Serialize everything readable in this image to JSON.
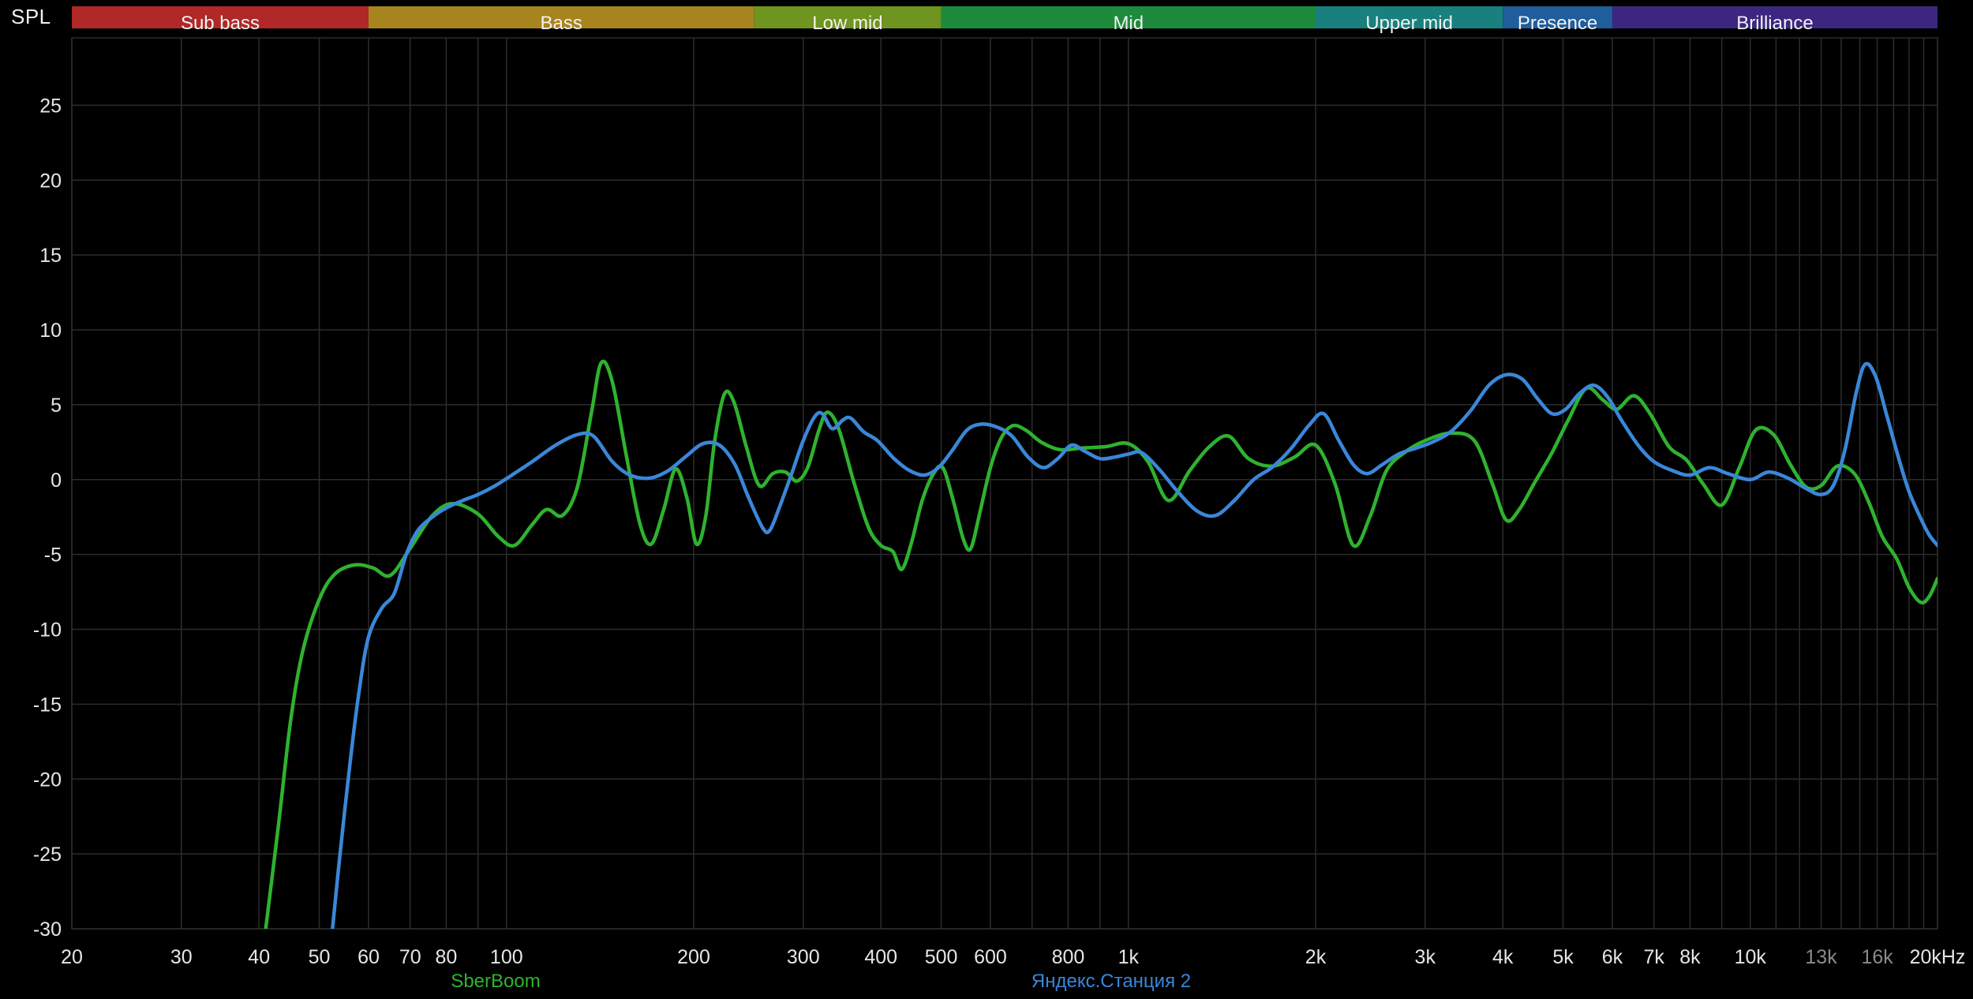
{
  "colors": {
    "background": "#000000",
    "grid": "#2c2c2c",
    "tick": "#e6e6e6",
    "tick_dim": "#8a8a8a",
    "band_text": "#f2f2f2"
  },
  "chart_data": {
    "type": "line",
    "title": "",
    "ylabel": "SPL",
    "xscale": "log",
    "xlim": [
      20,
      20000
    ],
    "ylim": [
      -30,
      29.5
    ],
    "grid": true,
    "legend_position": "bottom",
    "y_tick_values": [
      25,
      20,
      15,
      10,
      5,
      0,
      -5,
      -10,
      -15,
      -20,
      -25,
      -30
    ],
    "y_tick_labels": [
      "25",
      "20",
      "15",
      "10",
      "5",
      "0",
      "-5",
      "-10",
      "-15",
      "-20",
      "-25",
      "-30"
    ],
    "x_ticks": [
      {
        "f": 20,
        "label": "20",
        "dim": false
      },
      {
        "f": 30,
        "label": "30",
        "dim": false
      },
      {
        "f": 40,
        "label": "40",
        "dim": false
      },
      {
        "f": 50,
        "label": "50",
        "dim": false
      },
      {
        "f": 60,
        "label": "60",
        "dim": false
      },
      {
        "f": 70,
        "label": "70",
        "dim": false
      },
      {
        "f": 80,
        "label": "80",
        "dim": false
      },
      {
        "f": 100,
        "label": "100",
        "dim": false
      },
      {
        "f": 200,
        "label": "200",
        "dim": false
      },
      {
        "f": 300,
        "label": "300",
        "dim": false
      },
      {
        "f": 400,
        "label": "400",
        "dim": false
      },
      {
        "f": 500,
        "label": "500",
        "dim": false
      },
      {
        "f": 600,
        "label": "600",
        "dim": false
      },
      {
        "f": 800,
        "label": "800",
        "dim": false
      },
      {
        "f": 1000,
        "label": "1k",
        "dim": false
      },
      {
        "f": 2000,
        "label": "2k",
        "dim": false
      },
      {
        "f": 3000,
        "label": "3k",
        "dim": false
      },
      {
        "f": 4000,
        "label": "4k",
        "dim": false
      },
      {
        "f": 5000,
        "label": "5k",
        "dim": false
      },
      {
        "f": 6000,
        "label": "6k",
        "dim": false
      },
      {
        "f": 7000,
        "label": "7k",
        "dim": false
      },
      {
        "f": 8000,
        "label": "8k",
        "dim": false
      },
      {
        "f": 10000,
        "label": "10k",
        "dim": false
      },
      {
        "f": 13000,
        "label": "13k",
        "dim": true
      },
      {
        "f": 16000,
        "label": "16k",
        "dim": true
      },
      {
        "f": 20000,
        "label": "20kHz",
        "dim": false
      }
    ],
    "bands": [
      {
        "label": "Sub bass",
        "color": "#b02828",
        "f_start": 20,
        "f_end": 60
      },
      {
        "label": "Bass",
        "color": "#a8841f",
        "f_start": 60,
        "f_end": 250
      },
      {
        "label": "Low mid",
        "color": "#6f941f",
        "f_start": 250,
        "f_end": 500
      },
      {
        "label": "Mid",
        "color": "#1e8a3c",
        "f_start": 500,
        "f_end": 2000
      },
      {
        "label": "Upper mid",
        "color": "#19807d",
        "f_start": 2000,
        "f_end": 4000
      },
      {
        "label": "Presence",
        "color": "#1f5d9c",
        "f_start": 4000,
        "f_end": 6000
      },
      {
        "label": "Brilliance",
        "color": "#3c2680",
        "f_start": 6000,
        "f_end": 20000
      }
    ],
    "series": [
      {
        "name": "SberBoom",
        "color": "#2fb22f",
        "points": [
          [
            41,
            -30
          ],
          [
            43,
            -23
          ],
          [
            45,
            -16
          ],
          [
            47,
            -11.5
          ],
          [
            50,
            -8
          ],
          [
            53,
            -6.3
          ],
          [
            57,
            -5.7
          ],
          [
            61,
            -5.9
          ],
          [
            65,
            -6.4
          ],
          [
            70,
            -4.6
          ],
          [
            76,
            -2.4
          ],
          [
            82,
            -1.6
          ],
          [
            90,
            -2.3
          ],
          [
            97,
            -3.8
          ],
          [
            103,
            -4.4
          ],
          [
            110,
            -3.0
          ],
          [
            116,
            -2.0
          ],
          [
            123,
            -2.4
          ],
          [
            130,
            -0.5
          ],
          [
            137,
            4.5
          ],
          [
            142,
            7.8
          ],
          [
            148,
            6.5
          ],
          [
            156,
            1.5
          ],
          [
            164,
            -3.0
          ],
          [
            171,
            -4.3
          ],
          [
            179,
            -2.0
          ],
          [
            187,
            0.7
          ],
          [
            195,
            -1.2
          ],
          [
            202,
            -4.3
          ],
          [
            209,
            -2.5
          ],
          [
            216,
            2.5
          ],
          [
            224,
            5.7
          ],
          [
            232,
            5.2
          ],
          [
            243,
            2.2
          ],
          [
            255,
            -0.4
          ],
          [
            268,
            0.4
          ],
          [
            281,
            0.5
          ],
          [
            293,
            -0.1
          ],
          [
            305,
            0.8
          ],
          [
            318,
            3.3
          ],
          [
            328,
            4.5
          ],
          [
            342,
            3.4
          ],
          [
            362,
            -0.2
          ],
          [
            382,
            -3.2
          ],
          [
            400,
            -4.4
          ],
          [
            418,
            -4.8
          ],
          [
            432,
            -6.0
          ],
          [
            448,
            -4.2
          ],
          [
            466,
            -1.4
          ],
          [
            486,
            0.4
          ],
          [
            503,
            0.8
          ],
          [
            522,
            -1.3
          ],
          [
            543,
            -4.0
          ],
          [
            558,
            -4.6
          ],
          [
            577,
            -2.2
          ],
          [
            600,
            0.8
          ],
          [
            625,
            2.8
          ],
          [
            652,
            3.6
          ],
          [
            684,
            3.3
          ],
          [
            724,
            2.5
          ],
          [
            776,
            2.0
          ],
          [
            840,
            2.1
          ],
          [
            920,
            2.2
          ],
          [
            1000,
            2.4
          ],
          [
            1075,
            1.2
          ],
          [
            1160,
            -1.4
          ],
          [
            1255,
            0.6
          ],
          [
            1350,
            2.2
          ],
          [
            1450,
            2.9
          ],
          [
            1560,
            1.4
          ],
          [
            1700,
            0.9
          ],
          [
            1850,
            1.5
          ],
          [
            2000,
            2.3
          ],
          [
            2150,
            -0.3
          ],
          [
            2300,
            -4.4
          ],
          [
            2450,
            -2.4
          ],
          [
            2600,
            0.6
          ],
          [
            2800,
            1.9
          ],
          [
            3000,
            2.6
          ],
          [
            3300,
            3.1
          ],
          [
            3600,
            2.6
          ],
          [
            3850,
            -0.3
          ],
          [
            4050,
            -2.7
          ],
          [
            4250,
            -2.0
          ],
          [
            4500,
            -0.2
          ],
          [
            4800,
            1.8
          ],
          [
            5100,
            4.0
          ],
          [
            5450,
            6.1
          ],
          [
            5800,
            5.3
          ],
          [
            6100,
            4.7
          ],
          [
            6500,
            5.6
          ],
          [
            6900,
            4.4
          ],
          [
            7400,
            2.2
          ],
          [
            7900,
            1.3
          ],
          [
            8400,
            -0.3
          ],
          [
            9000,
            -1.7
          ],
          [
            9600,
            0.8
          ],
          [
            10200,
            3.3
          ],
          [
            10900,
            3.0
          ],
          [
            11600,
            1.0
          ],
          [
            12300,
            -0.5
          ],
          [
            13000,
            -0.4
          ],
          [
            13800,
            0.9
          ],
          [
            14700,
            0.4
          ],
          [
            15500,
            -1.5
          ],
          [
            16300,
            -3.8
          ],
          [
            17200,
            -5.3
          ],
          [
            18000,
            -7.2
          ],
          [
            18800,
            -8.2
          ],
          [
            19400,
            -7.8
          ],
          [
            20000,
            -6.6
          ]
        ]
      },
      {
        "name": "Яндекс.Станция 2",
        "color": "#3a87d8",
        "points": [
          [
            52.5,
            -30
          ],
          [
            54,
            -25
          ],
          [
            56,
            -19
          ],
          [
            58,
            -14
          ],
          [
            60,
            -10.5
          ],
          [
            63,
            -8.6
          ],
          [
            66,
            -7.6
          ],
          [
            69,
            -5.0
          ],
          [
            72,
            -3.4
          ],
          [
            76,
            -2.5
          ],
          [
            80,
            -1.9
          ],
          [
            85,
            -1.4
          ],
          [
            90,
            -1.0
          ],
          [
            96,
            -0.4
          ],
          [
            102,
            0.3
          ],
          [
            110,
            1.2
          ],
          [
            120,
            2.3
          ],
          [
            130,
            3.0
          ],
          [
            138,
            2.9
          ],
          [
            148,
            1.2
          ],
          [
            158,
            0.3
          ],
          [
            170,
            0.1
          ],
          [
            182,
            0.6
          ],
          [
            195,
            1.6
          ],
          [
            207,
            2.4
          ],
          [
            220,
            2.3
          ],
          [
            233,
            1.0
          ],
          [
            245,
            -1.2
          ],
          [
            258,
            -3.2
          ],
          [
            265,
            -3.4
          ],
          [
            275,
            -1.8
          ],
          [
            288,
            0.5
          ],
          [
            300,
            2.6
          ],
          [
            313,
            4.2
          ],
          [
            322,
            4.4
          ],
          [
            334,
            3.4
          ],
          [
            348,
            4.0
          ],
          [
            358,
            4.1
          ],
          [
            375,
            3.2
          ],
          [
            395,
            2.6
          ],
          [
            420,
            1.4
          ],
          [
            445,
            0.6
          ],
          [
            470,
            0.3
          ],
          [
            495,
            0.8
          ],
          [
            520,
            1.9
          ],
          [
            550,
            3.3
          ],
          [
            580,
            3.7
          ],
          [
            615,
            3.5
          ],
          [
            650,
            2.9
          ],
          [
            690,
            1.5
          ],
          [
            730,
            0.8
          ],
          [
            770,
            1.4
          ],
          [
            810,
            2.3
          ],
          [
            850,
            1.9
          ],
          [
            900,
            1.4
          ],
          [
            950,
            1.5
          ],
          [
            1000,
            1.7
          ],
          [
            1050,
            1.8
          ],
          [
            1120,
            0.7
          ],
          [
            1200,
            -0.8
          ],
          [
            1290,
            -2.1
          ],
          [
            1380,
            -2.4
          ],
          [
            1480,
            -1.4
          ],
          [
            1590,
            0.0
          ],
          [
            1700,
            0.8
          ],
          [
            1820,
            2.0
          ],
          [
            1950,
            3.6
          ],
          [
            2060,
            4.4
          ],
          [
            2180,
            2.6
          ],
          [
            2300,
            1.0
          ],
          [
            2420,
            0.4
          ],
          [
            2560,
            1.0
          ],
          [
            2720,
            1.7
          ],
          [
            2900,
            2.1
          ],
          [
            3080,
            2.5
          ],
          [
            3300,
            3.2
          ],
          [
            3550,
            4.6
          ],
          [
            3800,
            6.3
          ],
          [
            4050,
            7.0
          ],
          [
            4300,
            6.7
          ],
          [
            4550,
            5.4
          ],
          [
            4800,
            4.4
          ],
          [
            5050,
            4.7
          ],
          [
            5300,
            5.7
          ],
          [
            5600,
            6.3
          ],
          [
            5900,
            5.5
          ],
          [
            6200,
            4.0
          ],
          [
            6600,
            2.3
          ],
          [
            7000,
            1.2
          ],
          [
            7500,
            0.6
          ],
          [
            8000,
            0.3
          ],
          [
            8600,
            0.8
          ],
          [
            9200,
            0.4
          ],
          [
            10000,
            0.0
          ],
          [
            10700,
            0.5
          ],
          [
            11500,
            0.1
          ],
          [
            12300,
            -0.6
          ],
          [
            13000,
            -1.0
          ],
          [
            13600,
            -0.4
          ],
          [
            14200,
            2.0
          ],
          [
            14800,
            5.8
          ],
          [
            15300,
            7.7
          ],
          [
            15900,
            6.9
          ],
          [
            16600,
            4.2
          ],
          [
            17300,
            1.5
          ],
          [
            18000,
            -0.8
          ],
          [
            18800,
            -2.6
          ],
          [
            19400,
            -3.7
          ],
          [
            20000,
            -4.4
          ]
        ]
      }
    ]
  }
}
